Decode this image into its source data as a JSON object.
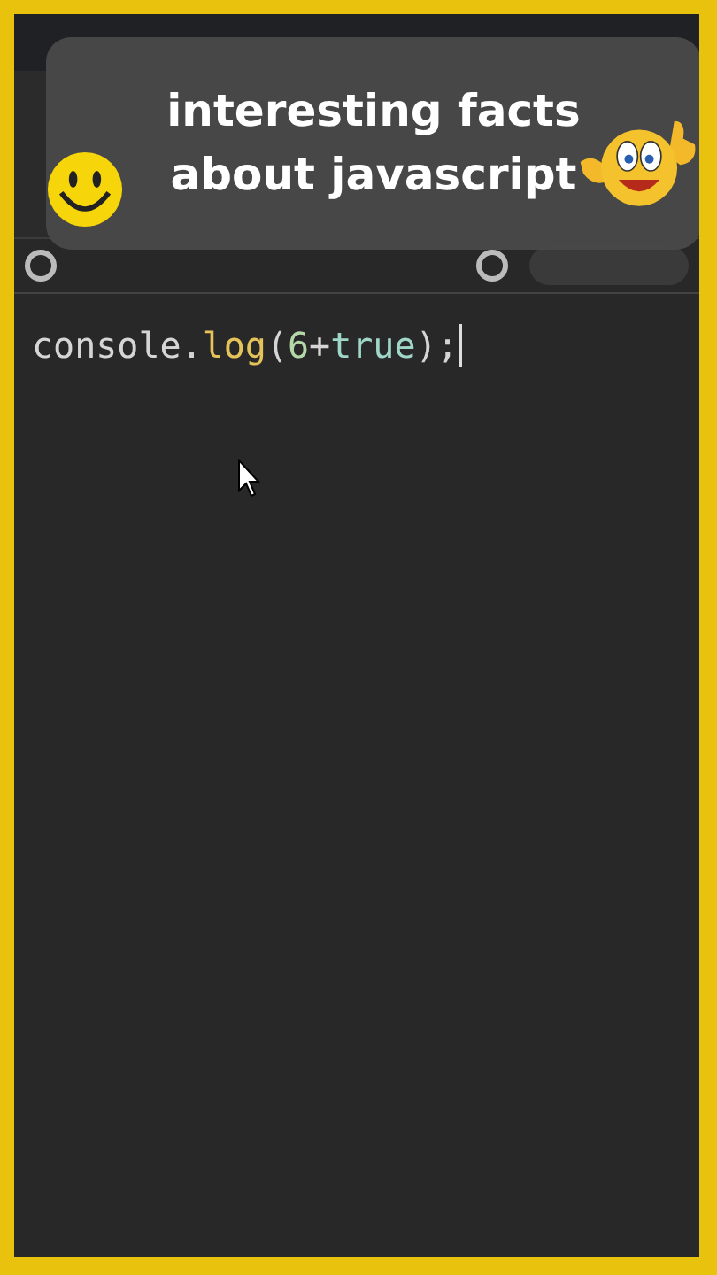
{
  "caption": {
    "lines": [
      "interesting facts",
      "about javascript"
    ]
  },
  "console": {
    "lines": [
      {
        "tokens": [
          {
            "text": "console.",
            "kind": "plain"
          },
          {
            "text": "log",
            "kind": "function"
          },
          {
            "text": "(",
            "kind": "plain"
          },
          {
            "text": "6",
            "kind": "number"
          },
          {
            "text": "+",
            "kind": "plain"
          },
          {
            "text": "true",
            "kind": "keyword"
          },
          {
            "text": ");",
            "kind": "plain"
          }
        ]
      }
    ]
  }
}
